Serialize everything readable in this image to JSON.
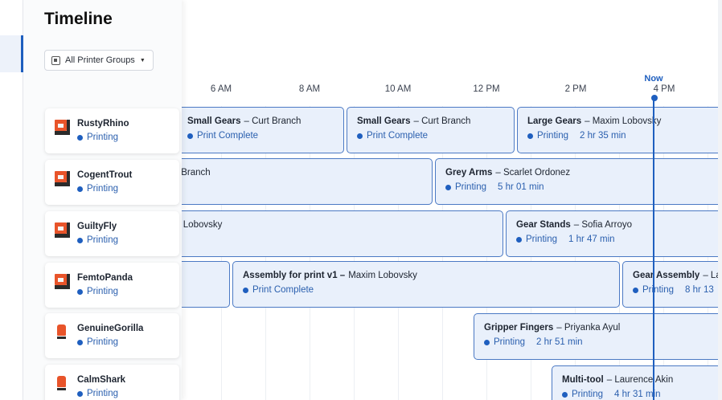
{
  "page": {
    "title": "Timeline"
  },
  "filter": {
    "label": "All Printer Groups"
  },
  "axis": {
    "ticks": [
      "6 AM",
      "8 AM",
      "10 AM",
      "12 PM",
      "2 PM",
      "4 PM"
    ],
    "now_label": "Now"
  },
  "printers": [
    {
      "name": "RustyRhino",
      "status": "Printing"
    },
    {
      "name": "CogentTrout",
      "status": "Printing"
    },
    {
      "name": "GuiltyFly",
      "status": "Printing"
    },
    {
      "name": "FemtoPanda",
      "status": "Printing"
    },
    {
      "name": "GenuineGorilla",
      "status": "Printing"
    },
    {
      "name": "CalmShark",
      "status": "Printing"
    }
  ],
  "jobs": [
    {
      "title": "Small Gears",
      "owner": "– Curt Branch",
      "status": "Print Complete",
      "remaining": ""
    },
    {
      "title": "Small Gears",
      "owner": "– Curt Branch",
      "status": "Print Complete",
      "remaining": ""
    },
    {
      "title": "Large Gears",
      "owner": "– Maxim Lobovsky",
      "status": "Printing",
      "remaining": "2 hr 35 min"
    },
    {
      "title": "",
      "owner": "rt Branch",
      "status": "",
      "remaining": ""
    },
    {
      "title": "Grey Arms",
      "owner": "– Scarlet Ordonez",
      "status": "Printing",
      "remaining": "5 hr 01 min"
    },
    {
      "title": "",
      "owner": "m Lobovsky",
      "status": "",
      "remaining": ""
    },
    {
      "title": "Gear Stands",
      "owner": "– Sofia Arroyo",
      "status": "Printing",
      "remaining": "1 hr 47 min"
    },
    {
      "title": "",
      "owner": "",
      "status": "",
      "remaining": ""
    },
    {
      "title": "Assembly for print v1 –",
      "owner": "Maxim Lobovsky",
      "status": "Print Complete",
      "remaining": ""
    },
    {
      "title": "Gear Assembly",
      "owner": "– La",
      "status": "Printing",
      "remaining": "8 hr 13"
    },
    {
      "title": "Gripper Fingers",
      "owner": "– Priyanka Ayul",
      "status": "Printing",
      "remaining": "2 hr 51 min"
    },
    {
      "title": "Multi-tool",
      "owner": "– Laurence Akin",
      "status": "Printing",
      "remaining": "4 hr 31 min"
    }
  ],
  "colors": {
    "accent": "#1f5fbf",
    "job_fill": "#e9f0fb",
    "printer_orange": "#e8542a"
  },
  "icons": {
    "printer": "printer-icon",
    "group": "printer-group-icon",
    "chevron": "chevron-down-icon"
  }
}
